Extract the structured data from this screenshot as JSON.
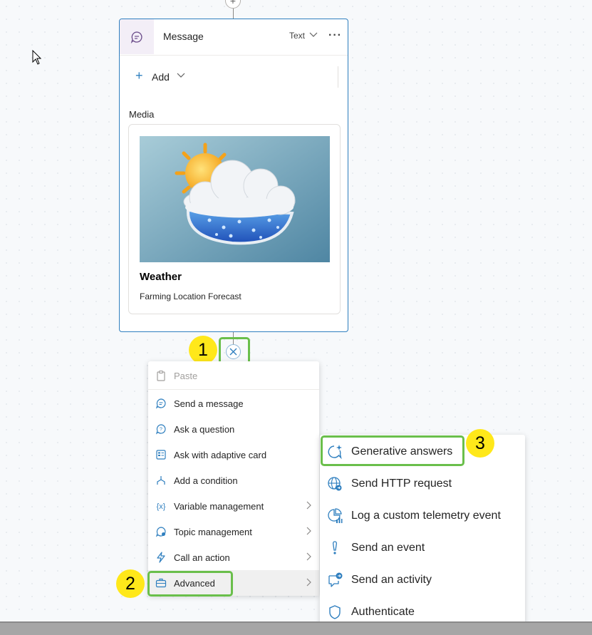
{
  "canvas": {
    "cursor_icon": "pointer-cursor-icon"
  },
  "message_node": {
    "title": "Message",
    "text_mode": "Text",
    "add_label": "Add",
    "media_label": "Media",
    "media_card": {
      "title": "Weather",
      "subtitle": "Farming Location Forecast"
    }
  },
  "badges": {
    "one": "1",
    "two": "2",
    "three": "3"
  },
  "node_menu": {
    "items": [
      {
        "label": "Paste",
        "icon": "paste-icon",
        "disabled": true
      },
      {
        "label": "Send a message",
        "icon": "message-icon"
      },
      {
        "label": "Ask a question",
        "icon": "question-icon"
      },
      {
        "label": "Ask with adaptive card",
        "icon": "adaptive-card-icon"
      },
      {
        "label": "Add a condition",
        "icon": "branch-icon"
      },
      {
        "label": "Variable management",
        "icon": "variable-icon",
        "submenu": true
      },
      {
        "label": "Topic management",
        "icon": "topic-icon",
        "submenu": true
      },
      {
        "label": "Call an action",
        "icon": "lightning-icon",
        "submenu": true
      },
      {
        "label": "Advanced",
        "icon": "briefcase-icon",
        "submenu": true,
        "active": true
      }
    ]
  },
  "advanced_menu": {
    "items": [
      {
        "label": "Generative answers",
        "icon": "sparkle-chat-icon"
      },
      {
        "label": "Send HTTP request",
        "icon": "globe-icon"
      },
      {
        "label": "Log a custom telemetry event",
        "icon": "telemetry-icon"
      },
      {
        "label": "Send an event",
        "icon": "exclamation-icon"
      },
      {
        "label": "Send an activity",
        "icon": "activity-icon"
      },
      {
        "label": "Authenticate",
        "icon": "shield-icon"
      }
    ]
  },
  "colors": {
    "accent": "#2f7fbf",
    "highlight": "#6abf4b",
    "badge": "#ffe81a"
  }
}
